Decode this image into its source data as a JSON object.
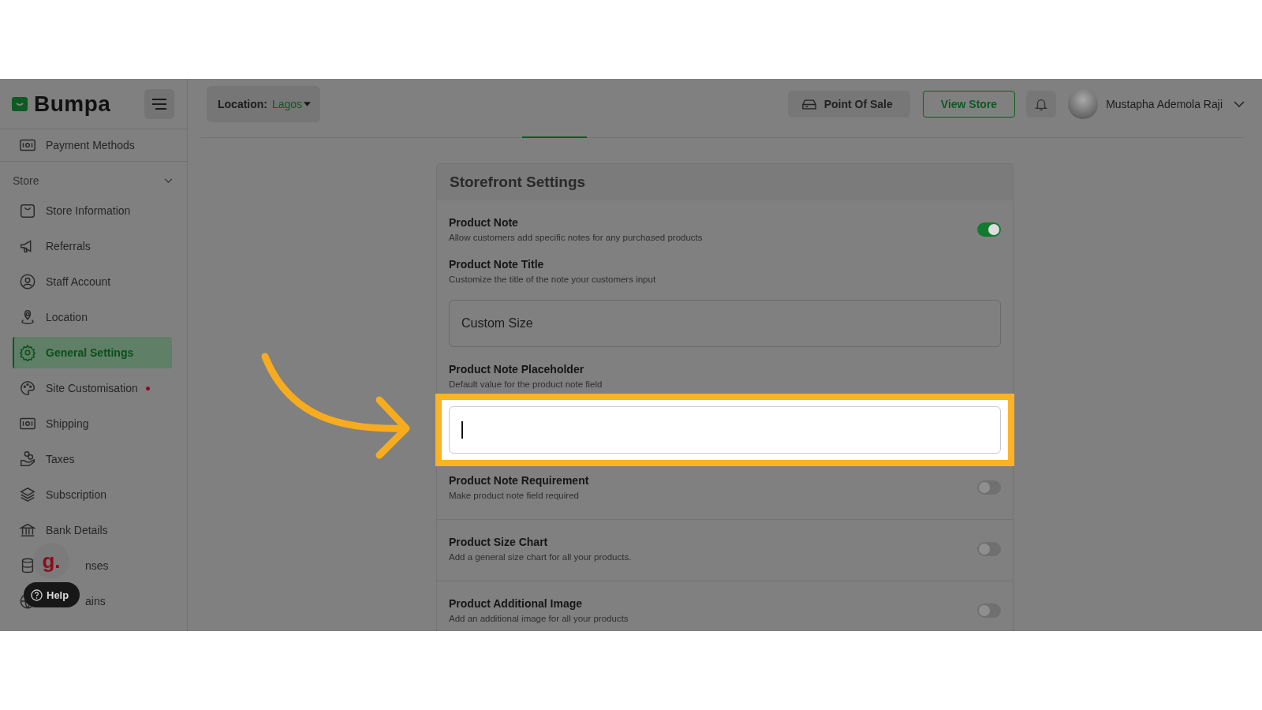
{
  "logo": {
    "text": "Bumpa"
  },
  "header": {
    "location_label": "Location:",
    "location_value": "Lagos",
    "pos_button": "Point Of Sale",
    "view_store_button": "View Store",
    "user_name": "Mustapha Ademola Raji"
  },
  "sidebar": {
    "top_item": {
      "label": "Payment Methods"
    },
    "section": {
      "label": "Store",
      "expanded": true
    },
    "items": [
      {
        "label": "Store Information",
        "selected": false,
        "alert": false
      },
      {
        "label": "Referrals",
        "selected": false,
        "alert": false
      },
      {
        "label": "Staff Account",
        "selected": false,
        "alert": false
      },
      {
        "label": "Location",
        "selected": false,
        "alert": false
      },
      {
        "label": "General Settings",
        "selected": true,
        "alert": false
      },
      {
        "label": "Site Customisation",
        "selected": false,
        "alert": true
      },
      {
        "label": "Shipping",
        "selected": false,
        "alert": false
      },
      {
        "label": "Taxes",
        "selected": false,
        "alert": false
      },
      {
        "label": "Subscription",
        "selected": false,
        "alert": false
      },
      {
        "label": "Bank Details",
        "selected": false,
        "alert": false
      },
      {
        "label": "nses",
        "selected": false,
        "alert": false,
        "kind": "covered"
      },
      {
        "label": "ains",
        "selected": false,
        "alert": false,
        "kind": "covered"
      }
    ]
  },
  "help_widget": {
    "badge": "g.",
    "button": "Help"
  },
  "card": {
    "title": "Storefront Settings",
    "groups": [
      {
        "rows": [
          {
            "kind": "toggle",
            "label": "Product Note",
            "description": "Allow customers add specific notes for any purchased products",
            "on": true
          },
          {
            "kind": "field",
            "label": "Product Note Title",
            "description": "Customize the title of the note your customers input",
            "value": "Custom Size",
            "focused": false,
            "highlighted": false
          },
          {
            "kind": "field",
            "label": "Product Note Placeholder",
            "description": "Default value for the product note field",
            "focused": true,
            "highlighted": true
          },
          {
            "kind": "toggle",
            "label": "Product Note Requirement",
            "description": "Make product note field required",
            "on": false
          }
        ]
      },
      {
        "rows": [
          {
            "kind": "toggle",
            "label": "Product Size Chart",
            "description": "Add a general size chart for all your products.",
            "on": false
          }
        ]
      },
      {
        "rows": [
          {
            "kind": "toggle",
            "label": "Product Additional Image",
            "description": "Add an additional image for all your products",
            "on": false
          }
        ]
      }
    ]
  }
}
